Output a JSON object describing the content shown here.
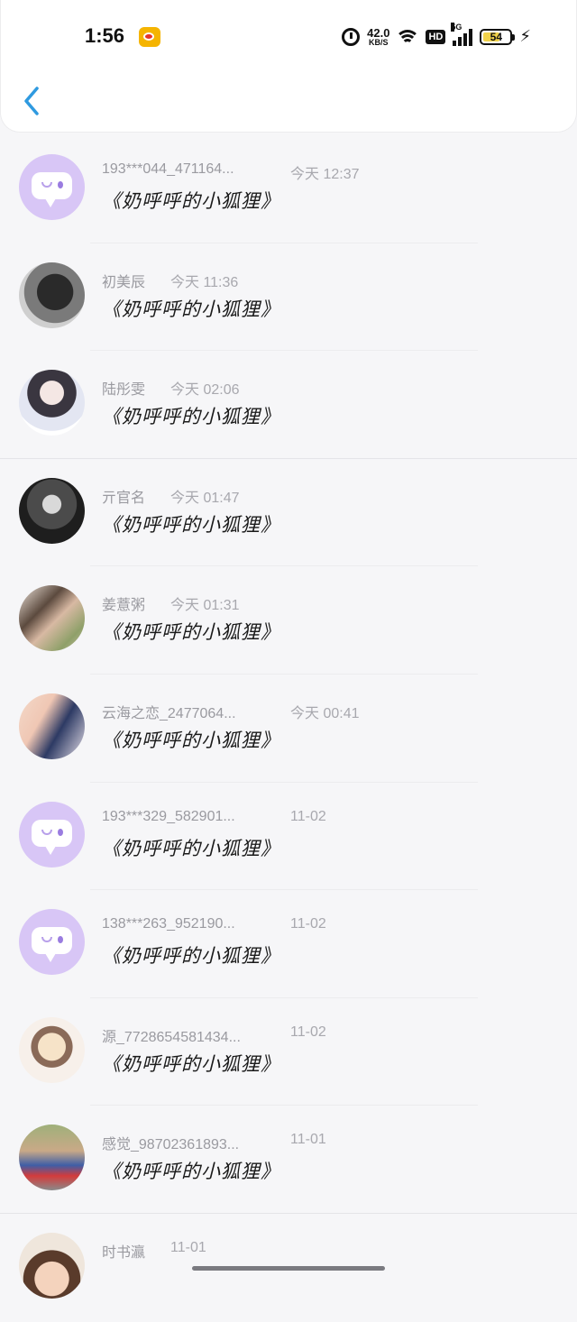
{
  "status_bar": {
    "time": "1:56",
    "net_speed_value": "42.0",
    "net_speed_unit": "KB/S",
    "hd_label": "HD",
    "network_label": "5G",
    "battery_level": "54",
    "app_notification_icon": "weibo-icon"
  },
  "header": {
    "back_icon": "chevron-left-icon",
    "back_color": "#2f9ae0"
  },
  "messages": [
    {
      "name": "193***044_471164...",
      "time": "今天 12:37",
      "text": "《奶呼呼的小狐狸》",
      "avatar": "default"
    },
    {
      "name": "初美辰",
      "time": "今天 11:36",
      "text": "《奶呼呼的小狐狸》",
      "avatar": "photo"
    },
    {
      "name": "陆彤雯",
      "time": "今天 02:06",
      "text": "《奶呼呼的小狐狸》",
      "avatar": "photo"
    },
    {
      "name": "亓官名",
      "time": "今天 01:47",
      "text": "《奶呼呼的小狐狸》",
      "avatar": "photo"
    },
    {
      "name": "姜薏粥",
      "time": "今天 01:31",
      "text": "《奶呼呼的小狐狸》",
      "avatar": "photo"
    },
    {
      "name": "云海之恋_2477064...",
      "time": "今天 00:41",
      "text": "《奶呼呼的小狐狸》",
      "avatar": "photo"
    },
    {
      "name": "193***329_582901...",
      "time": "11-02",
      "text": "《奶呼呼的小狐狸》",
      "avatar": "default"
    },
    {
      "name": "138***263_952190...",
      "time": "11-02",
      "text": "《奶呼呼的小狐狸》",
      "avatar": "default"
    },
    {
      "name": "源_7728654581434...",
      "time": "11-02",
      "text": "《奶呼呼的小狐狸》",
      "avatar": "photo"
    },
    {
      "name": "感觉_98702361893...",
      "time": "11-01",
      "text": "《奶呼呼的小狐狸》",
      "avatar": "photo"
    },
    {
      "name": "时书瀛",
      "time": "11-01",
      "text": "",
      "avatar": "photo"
    }
  ]
}
